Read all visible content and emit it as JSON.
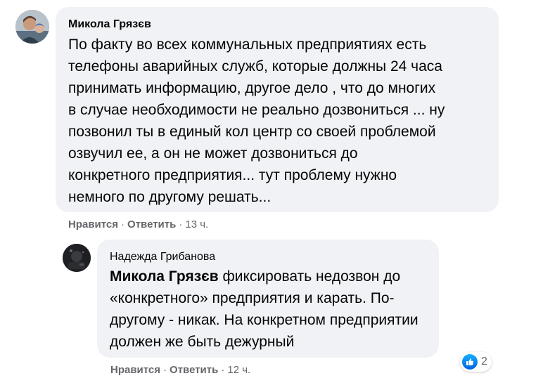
{
  "comment": {
    "author": "Микола Грязєв",
    "text": "По факту во всех коммунальных предприятиях есть\nтелефоны аварийных служб, которые должны 24 часа\nпринимать информацию, другое дело , что до многих\nв случае необходимости не реально дозвониться ... ну\nпозвонил ты в единый кол центр со своей проблемой\nозвучил ее, а он не может дозвониться до\nконкретного предприятия... тут проблему нужно\nнемного по другому решать...",
    "like_label": "Нравится",
    "reply_label": "Ответить",
    "separator": "·",
    "time": "13 ч."
  },
  "reply": {
    "author": "Надежда Грибанова",
    "mention": "Микола Грязєв",
    "text": " фиксировать недозвон до\n«конкретного» предприятия и карать. По-\nдругому - никак. На конкретном предприятии\nдолжен же быть дежурный",
    "like_label": "Нравится",
    "reply_label": "Ответить",
    "separator": "·",
    "time": "12 ч.",
    "reactions": {
      "icon": "like-icon",
      "count": "2"
    }
  },
  "colors": {
    "bubble": "#f0f2f5",
    "secondary_text": "#65676b",
    "like_blue": "#1877f2"
  }
}
